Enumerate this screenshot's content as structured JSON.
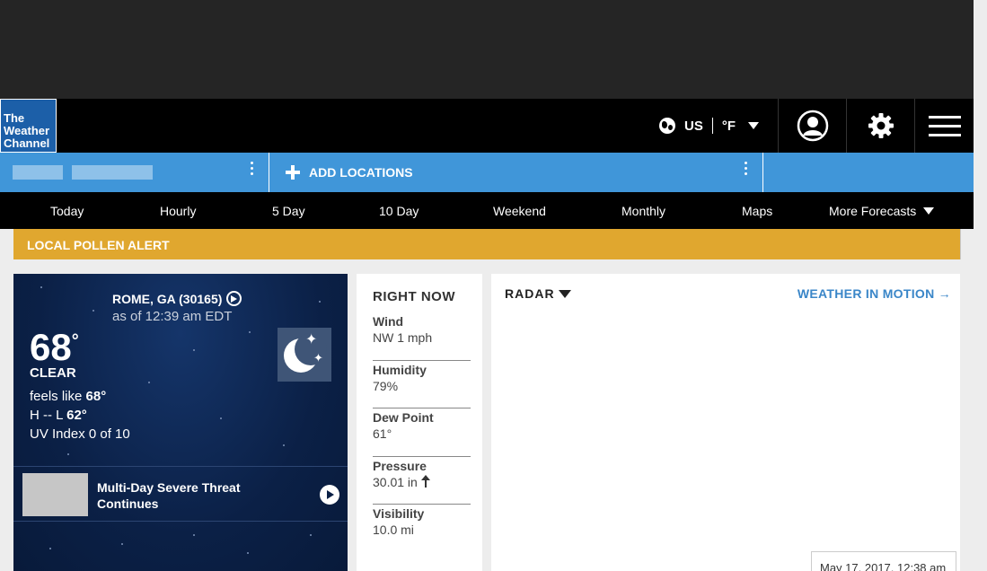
{
  "header": {
    "logo_lines": [
      "The",
      "Weather",
      "Channel"
    ],
    "region": "US",
    "unit": "°F"
  },
  "locations": {
    "add_label": "ADD LOCATIONS"
  },
  "nav": {
    "items": [
      "Today",
      "Hourly",
      "5 Day",
      "10 Day",
      "Weekend",
      "Monthly",
      "Maps",
      "More Forecasts"
    ]
  },
  "alert": {
    "text": "LOCAL POLLEN ALERT"
  },
  "current": {
    "location": "ROME, GA (30165)",
    "as_of": "as of 12:39 am EDT",
    "temp": "68",
    "degree": "°",
    "phrase": "CLEAR",
    "feels_prefix": "feels like ",
    "feels_value": "68°",
    "hilo_prefix": "H -- L ",
    "hilo_value": "62°",
    "uv": "UV Index 0 of 10",
    "video_title": "Multi-Day Severe Threat Continues"
  },
  "right_now": {
    "title": "RIGHT NOW",
    "items": [
      {
        "label": "Wind",
        "value": "NW 1 mph"
      },
      {
        "label": "Humidity",
        "value": "79%"
      },
      {
        "label": "Dew Point",
        "value": "61°"
      },
      {
        "label": "Pressure",
        "value": "30.01 in"
      },
      {
        "label": "Visibility",
        "value": "10.0 mi"
      }
    ]
  },
  "radar": {
    "title": "RADAR",
    "link": "WEATHER IN MOTION →",
    "timestamp": "May 17, 2017, 12:38 am"
  },
  "colors": {
    "brand": "#1c5fa8",
    "loc_bar": "#4096d9",
    "alert": "#e0a72f",
    "link": "#3a86c8"
  }
}
